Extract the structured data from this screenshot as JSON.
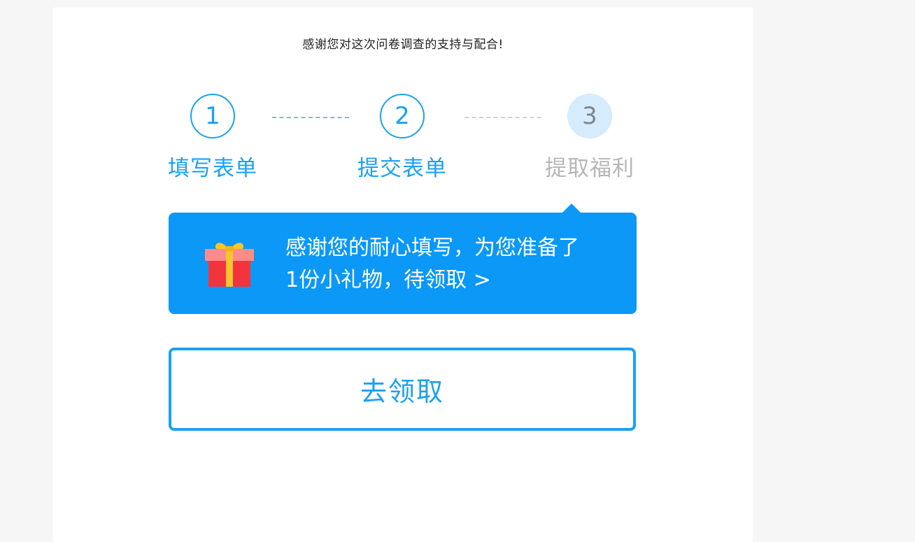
{
  "header": {
    "thanks_text": "感谢您对这次问卷调查的支持与配合!"
  },
  "steps": [
    {
      "number": "1",
      "label": "填写表单",
      "state": "done"
    },
    {
      "number": "2",
      "label": "提交表单",
      "state": "done"
    },
    {
      "number": "3",
      "label": "提取福利",
      "state": "current"
    }
  ],
  "reward": {
    "line1": "感谢您的耐心填写，为您准备了",
    "line2": "1份小礼物，待领取 >",
    "icon": "gift-icon"
  },
  "claim_button": {
    "label": "去领取"
  },
  "colors": {
    "accent": "#1aa1f5",
    "banner": "#0b98f7",
    "pending_circle": "#d6ebfb",
    "pending_text": "#b7b7b7"
  }
}
